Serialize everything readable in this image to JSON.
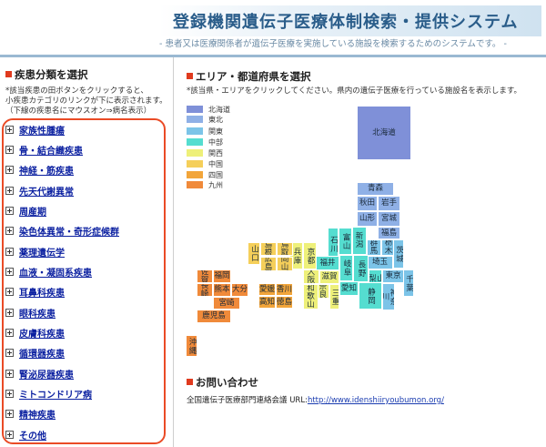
{
  "header": {
    "title": "登録機関遺伝子医療体制検索・提供システム",
    "subtitle": "- 患者又は医療関係者が遺伝子医療を実施している施設を検索するためのシステムです。 -"
  },
  "left": {
    "section_title": "疾患分類を選択",
    "note_line1": "*該当疾患の田ボタンをクリックすると、",
    "note_line2": "小疾患カテゴリのリンクが下に表示されます。",
    "note_line3": "（下線の疾患名にマウスオン⇒病名表示）",
    "categories": [
      {
        "label": "家族性腫瘍"
      },
      {
        "label": "骨・結合織疾患"
      },
      {
        "label": "神経・筋疾患"
      },
      {
        "label": "先天代謝異常"
      },
      {
        "label": "周産期"
      },
      {
        "label": "染色体異常・奇形症候群"
      },
      {
        "label": "薬理遺伝学"
      },
      {
        "label": "血液・凝固系疾患"
      },
      {
        "label": "耳鼻科疾患"
      },
      {
        "label": "眼科疾患"
      },
      {
        "label": "皮膚科疾患"
      },
      {
        "label": "循環器疾患"
      },
      {
        "label": "腎泌尿器疾患"
      },
      {
        "label": "ミトコンドリア病"
      },
      {
        "label": "精神疾患"
      },
      {
        "label": "その他"
      }
    ]
  },
  "map": {
    "section_title": "エリア・都道府県を選択",
    "note": "*該当県・エリアをクリックしてください。県内の遺伝子医療を行っている施設名を表示します。",
    "legend": [
      {
        "label": "北海道",
        "color": "#7f90d8"
      },
      {
        "label": "東北",
        "color": "#8fb0e6"
      },
      {
        "label": "関東",
        "color": "#7cc4e8"
      },
      {
        "label": "中部",
        "color": "#55ddd0"
      },
      {
        "label": "関西",
        "color": "#eef07a"
      },
      {
        "label": "中国",
        "color": "#f5cf5a"
      },
      {
        "label": "四国",
        "color": "#f2a53a"
      },
      {
        "label": "九州",
        "color": "#f08a3a"
      }
    ],
    "prefectures": {
      "hokkaido": "北海道",
      "aomori": "青森",
      "akita": "秋田",
      "iwate": "岩手",
      "yamagata": "山形",
      "miyagi": "宮城",
      "fukushima": "福島",
      "niigata": "新潟",
      "gunma": "群馬",
      "tochigi": "栃木",
      "ibaraki": "茨城",
      "saitama": "埼玉",
      "chiba": "千葉",
      "tokyo": "東京",
      "kanagawa": "神奈川",
      "yamanashi": "山梨",
      "nagano": "長野",
      "ishikawa": "石川",
      "toyama": "富山",
      "fukui": "福井",
      "gifu": "岐阜",
      "aichi": "愛知",
      "shizuoka": "静岡",
      "kyoto": "京都",
      "hyogo": "兵庫",
      "osaka": "大阪",
      "shiga": "滋賀",
      "nara": "奈良",
      "mie": "三重",
      "wakayama": "和歌山",
      "shimane": "島根",
      "tottori": "鳥取",
      "okayama": "岡山",
      "hiroshima": "広島",
      "yamaguchi": "山口",
      "ehime": "愛媛",
      "kagawa": "香川",
      "kochi": "高知",
      "tokushima": "徳島",
      "saga": "佐賀",
      "fukuoka": "福岡",
      "nagasaki": "長崎",
      "kumamoto": "熊本",
      "oita": "大分",
      "miyazaki": "宮崎",
      "kagoshima": "鹿児島",
      "okinawa": "沖縄"
    }
  },
  "contact": {
    "section_title": "お問い合わせ",
    "org": "全国遺伝子医療部門連絡会議 URL:",
    "url": "http://www.idenshiiryoubumon.org/"
  }
}
